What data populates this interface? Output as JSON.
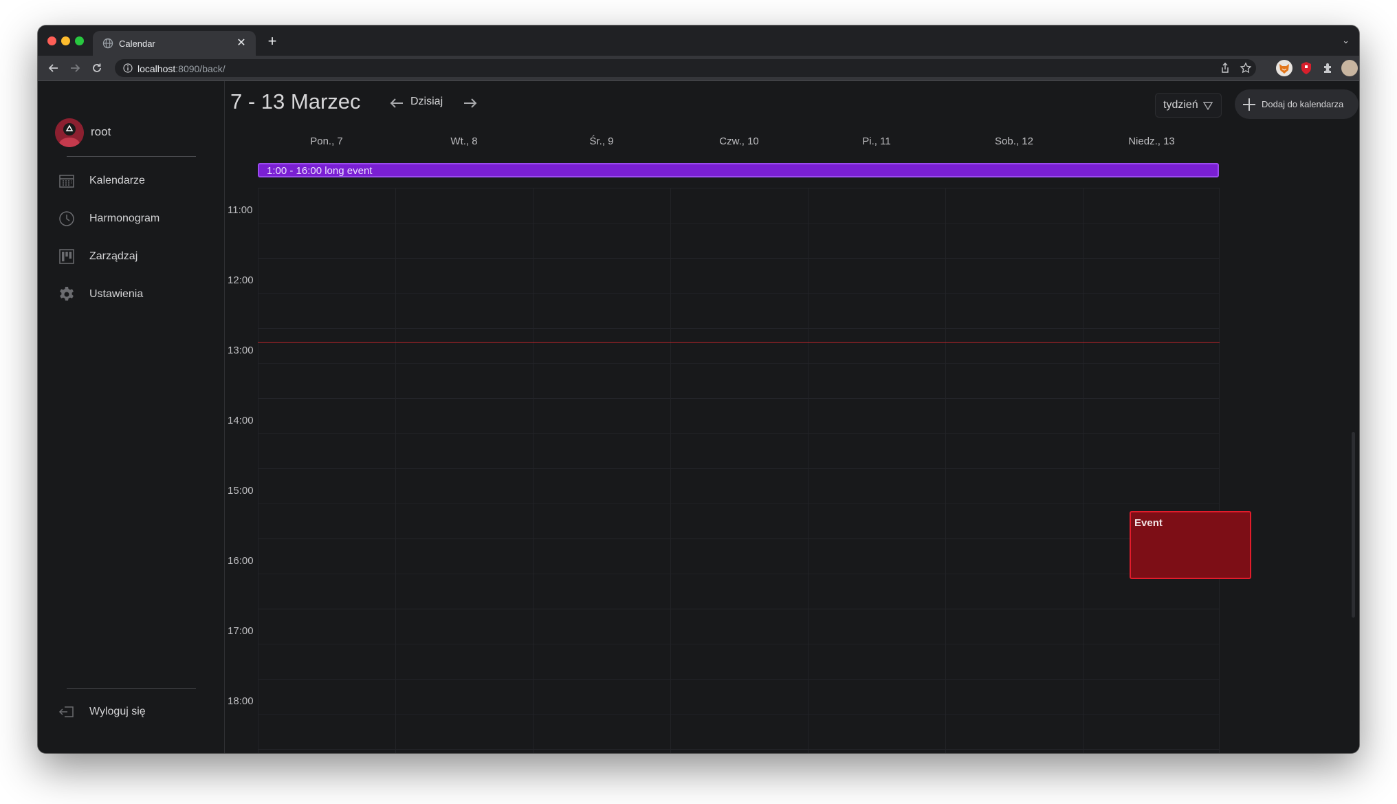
{
  "browser": {
    "tab_title": "Calendar",
    "url_host": "localhost",
    "url_rest": ":8090/back/",
    "icons": {
      "favicon": "globe-icon",
      "close": "close-icon",
      "new_tab": "plus-icon",
      "back": "arrow-left-icon",
      "forward": "arrow-right-icon",
      "reload": "reload-icon",
      "info": "info-icon",
      "share": "share-icon",
      "bookmark": "star-icon",
      "extensions": "puzzle-icon",
      "menu": "kebab-menu-icon"
    }
  },
  "sidebar": {
    "username": "root",
    "items": [
      {
        "label": "Kalendarze",
        "icon": "calendar-grid-icon"
      },
      {
        "label": "Harmonogram",
        "icon": "clock-icon"
      },
      {
        "label": "Zarządzaj",
        "icon": "kanban-icon"
      },
      {
        "label": "Ustawienia",
        "icon": "gear-icon"
      }
    ],
    "logout_label": "Wyloguj się"
  },
  "header": {
    "range_title": "7 - 13 Marzec",
    "today_label": "Dzisiaj",
    "view_label": "tydzień",
    "add_label": "Dodaj do kalendarza"
  },
  "days": [
    "Pon., 7",
    "Wt., 8",
    "Śr., 9",
    "Czw., 10",
    "Pi., 11",
    "Sob., 12",
    "Niedz., 13"
  ],
  "allday_event": "1:00 - 16:00 long event",
  "hours": [
    "11:00",
    "12:00",
    "13:00",
    "14:00",
    "15:00",
    "16:00",
    "17:00",
    "18:00"
  ],
  "events": [
    {
      "title": "Event",
      "day": "Niedz., 13",
      "start": "15:00",
      "end": "16:00",
      "color": "#e21c2b"
    }
  ],
  "colors": {
    "background": "#18191b",
    "allday_event": "#7a1fd3",
    "event": "#7d0e16",
    "now_line": "#c0242b"
  }
}
